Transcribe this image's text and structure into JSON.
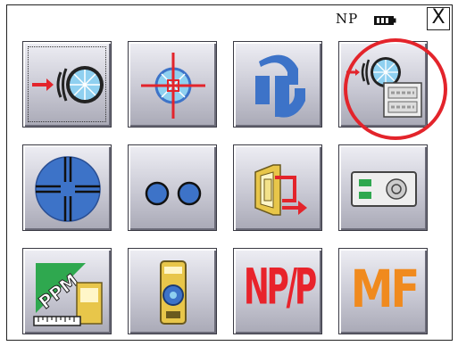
{
  "status": {
    "mode_label": "NP",
    "battery_icon": "battery-icon",
    "close_label": "X"
  },
  "tiles": [
    {
      "name": "edm-measure-tile",
      "icon": "edm-signal-prism-icon"
    },
    {
      "name": "target-tile",
      "icon": "crosshair-target-icon"
    },
    {
      "name": "swap-tile",
      "icon": "swap-arrows-icon"
    },
    {
      "name": "edm-memory-tile",
      "icon": "edm-signal-keypad-icon"
    },
    {
      "name": "reticle-tile",
      "icon": "reticle-icon"
    },
    {
      "name": "dots-tile",
      "icon": "two-dots-icon"
    },
    {
      "name": "export-tile",
      "icon": "export-arrow-icon"
    },
    {
      "name": "storage-tile",
      "icon": "storage-device-icon"
    },
    {
      "name": "ppm-tile",
      "icon": "ppm-ruler-icon"
    },
    {
      "name": "prism-tile",
      "icon": "prism-holder-icon"
    },
    {
      "name": "np-p-tile",
      "label": "NP/P"
    },
    {
      "name": "mf-tile",
      "label": "MF"
    }
  ],
  "colors": {
    "accent_red": "#e3242b",
    "icon_blue": "#3d73c8",
    "light_blue": "#8fd0f0",
    "orange": "#f08a1e",
    "green": "#2fa84f",
    "yellow": "#e8c64a"
  }
}
